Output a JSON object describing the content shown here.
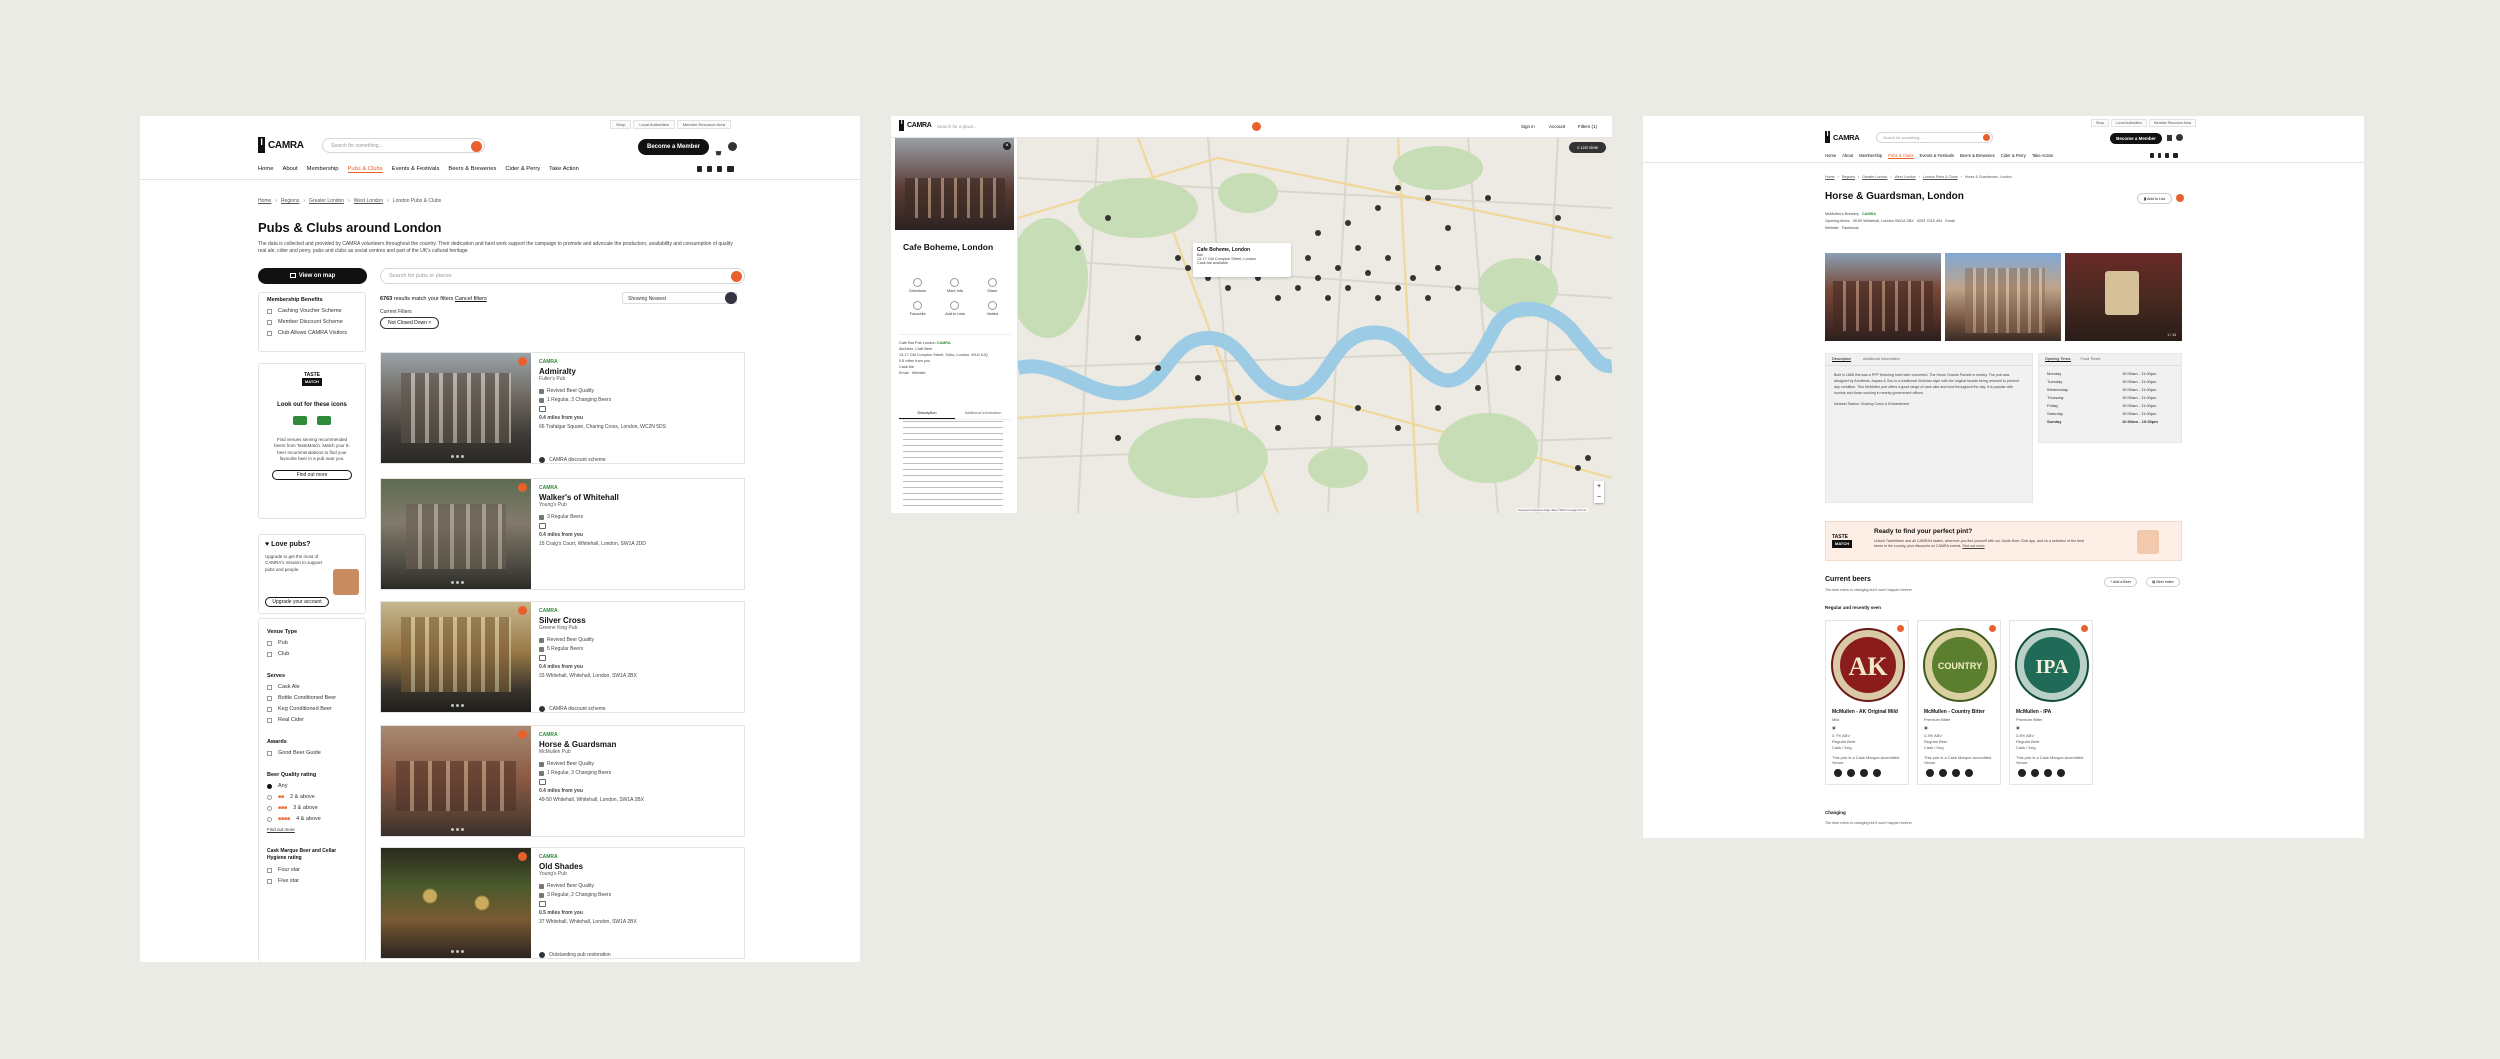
{
  "colors": {
    "accent": "#e8602c",
    "dark": "#111111",
    "green": "#2e8b3a",
    "page_bg": "#ebebe6"
  },
  "brand": {
    "logo_text": "CAMRA",
    "member_button": "Become a Member"
  },
  "search_placeholder": "Search for something...",
  "utility_links": [
    "Shop",
    "Local Authorities",
    "Member Resource Area"
  ],
  "nav": [
    "Home",
    "About",
    "Membership",
    "Pubs & Clubs",
    "Events & Festivals",
    "Beers & Breweries",
    "Cider & Perry",
    "Take Action"
  ],
  "listing": {
    "breadcrumb": [
      "Home",
      "Regions",
      "Greater London",
      "West London",
      "London Pubs & Clubs"
    ],
    "title": "Pubs & Clubs around London",
    "description": "The data is collected and provided by CAMRA volunteers throughout the country. Their dedication and hard work support the campaign to promote and advocate the production, availability and consumption of quality real ale, cider and perry, pubs and clubs as social centres and part of the UK's cultural heritage.",
    "view_map": "View on map",
    "pub_search_placeholder": "Search for pubs or places",
    "results_count": "6763",
    "results_text": "results match your filters",
    "cancel_filters": "Cancel filters",
    "sort": "Showing Nearest",
    "current_filters_label": "Current Filters",
    "current_filter_chip": "Not Closed Down",
    "membership_benefits": {
      "title": "Membership Benefits",
      "items": [
        "Cashing Voucher Scheme",
        "Member Discount Scheme",
        "Club Allows CAMRA Visitors"
      ]
    },
    "taste": {
      "logo_top": "TASTE",
      "logo_bottom": "MATCH",
      "heading": "Look out for these icons",
      "body": "Find venues serving recommended beers from TasteMatch. Match your 5-beer recommendations to find your favourite beer in a pub near you.",
      "button": "Find out more"
    },
    "love": {
      "heading": "Love pubs?",
      "body": "Upgrade to get the most of CAMRA's mission to support pubs and people.",
      "button": "Upgrade your account"
    },
    "venue_type": {
      "title": "Venue Type",
      "items": [
        "Pub",
        "Club"
      ]
    },
    "serves": {
      "title": "Serves",
      "items": [
        "Cask Ale",
        "Bottle Conditioned Beer",
        "Keg Conditioned Beer",
        "Real Cider"
      ]
    },
    "awards": {
      "title": "Awards",
      "items": [
        "Good Beer Guide"
      ]
    },
    "beer_rating": {
      "title": "Beer Quality rating",
      "items": [
        "Any",
        "2 & above",
        "3 & above",
        "4 & above"
      ],
      "link": "Find out more"
    },
    "last_filter": {
      "title": "Cask Marque Beer and Cellar Hygiene rating",
      "items": [
        "Four star",
        "Five star"
      ]
    },
    "pubs": [
      {
        "badge": "CAMRA",
        "name": "Admiralty",
        "type": "Fuller's Pub",
        "lines": [
          "Revived Beer Quality",
          "1 Regular, 3 Changing Beers",
          "",
          "0.4 miles from you",
          "66 Trafalgar Square, Charing Cross, London, WC2N 5DS"
        ],
        "note": "CAMRA discount scheme"
      },
      {
        "badge": "CAMRA",
        "name": "Walker's of Whitehall",
        "type": "Young's Pub",
        "lines": [
          "3 Regular Beers",
          "",
          "0.4 miles from you",
          "15 Craig's Court, Whitehall, London, SW1A 2DD"
        ],
        "note": ""
      },
      {
        "badge": "CAMRA",
        "name": "Silver Cross",
        "type": "Greene King Pub",
        "lines": [
          "Revived Beer Quality",
          "5 Regular Beers",
          "",
          "0.4 miles from you",
          "33 Whitehall, Whitehall, London, SW1A 2BX"
        ],
        "note": "CAMRA discount scheme"
      },
      {
        "badge": "CAMRA",
        "name": "Horse & Guardsman",
        "type": "McMullen Pub",
        "lines": [
          "Revived Beer Quality",
          "1 Regular, 3 Changing Beers",
          "",
          "0.4 miles from you",
          "49-50 Whitehall, Whitehall, London, SW1A 2BX"
        ],
        "note": ""
      },
      {
        "badge": "CAMRA",
        "name": "Old Shades",
        "type": "Young's Pub",
        "lines": [
          "Revived Beer Quality",
          "3 Regular, 2 Changing Beers",
          "",
          "0.5 miles from you",
          "37 Whitehall, Whitehall, London, SW1A 2BX"
        ],
        "note": "Outstanding pub restoration"
      }
    ]
  },
  "map_view": {
    "search_placeholder": "Search for a place...",
    "top_links": [
      "Sign in",
      "Account",
      "Filters (1)"
    ],
    "list_view": "List view",
    "venue_name": "Cafe Boheme, London",
    "actions": [
      "Directions",
      "More Info",
      "Share",
      "Favourite",
      "Add to Lists",
      "Visited"
    ],
    "camra_label": "CAMRA",
    "details": [
      "Cafe Bar Pub London",
      "Ale/beer, Craft Beer",
      "13-17 Old Compton Street, Soho, London, W1D 5JQ",
      "0.8 miles from you",
      "Cask Ale",
      "Email",
      "Website"
    ],
    "tabs": [
      "Description",
      "Additional Information"
    ],
    "popup_title": "Cafe Boheme, London",
    "popup_lines": [
      "Bar",
      "13-17 Old Compton Street, London",
      "Cask Ale available"
    ],
    "attribution": "Keyboard shortcuts  Map data ©2023 Google  Terms"
  },
  "detail": {
    "breadcrumb": [
      "Home",
      "Regions",
      "Greater London",
      "West London",
      "London Pubs & Clubs",
      "Horse & Guardsman, London"
    ],
    "title": "Horse & Guardsman, London",
    "save_button": "Add to List",
    "meta": [
      "McMullen's Brewery",
      "CAMRA",
      "Opening times",
      "49-50 Whitehall, London SW1A 2BX",
      "0203 7015 404",
      "Email",
      "Website",
      "Facebook"
    ],
    "tabs": [
      "Description",
      "Additional Information"
    ],
    "hours_tabs": [
      "Opening Times",
      "Food Times"
    ],
    "description": "Built in 1888 this was a PPP Motoring hotel later converted. The Horse Guards Parade is nearby. The pub was designed by Architects Jaques & Son to a traditional Victorian style with the original facade being restored to present day condition. This McMullen pub offers a good range of cask ales and food throughout the day. It is popular with tourists and those working in nearby government offices.",
    "nearest": "Nearest Station: Charing Cross & Embankment",
    "hours": [
      [
        "Monday",
        "10:00am - 11:00pm"
      ],
      [
        "Tuesday",
        "10:00am - 11:00pm"
      ],
      [
        "Wednesday",
        "10:00am - 11:00pm"
      ],
      [
        "Thursday",
        "10:00am - 11:00pm"
      ],
      [
        "Friday",
        "10:00am - 11:00pm"
      ],
      [
        "Saturday",
        "10:00am - 11:00pm"
      ],
      [
        "Sunday",
        "10:00am - 10:30pm"
      ]
    ],
    "taste_banner": {
      "heading": "Ready to find your perfect pint?",
      "body": "Unlock TasteMatch and all CAMRA's tastes, wherever you find yourself with our Guide Beer Club app, and on a selection of the best beers in the country, plus discounts on CAMRA events.",
      "link": "Find out more"
    },
    "current_beers": "Current beers",
    "current_beers_sub": "The beer menu is changing but it won't happen forever.",
    "beer_buttons": [
      "Add a Beer",
      "Beer Index"
    ],
    "regular_label": "Regular and recently seen",
    "beers": [
      {
        "badge": "AK",
        "name": "McMullen - AK Original Mild",
        "style": "Mild",
        "abv": "3.7% ABV",
        "lines": [
          "3.7% ABV",
          "Regular Beer",
          "Cask / Keg"
        ],
        "color": "#8a1c1c",
        "ring": "#d9c9a6"
      },
      {
        "badge": "COUNTRY",
        "name": "McMullen - Country Bitter",
        "style": "Premium Bitter",
        "abv": "4.3% ABV",
        "lines": [
          "4.3% ABV",
          "Regular Beer",
          "Cask / Keg"
        ],
        "color": "#5b7f2e",
        "ring": "#d9d2a0"
      },
      {
        "badge": "IPA",
        "name": "McMullen - IPA",
        "style": "Premium Bitter",
        "abv": "3.8% ABV",
        "lines": [
          "3.8% ABV",
          "Regular Beer",
          "Cask / Keg"
        ],
        "color": "#1f6b57",
        "ring": "#b9d0c7"
      }
    ],
    "beer_footer": "This pub is a Cask Marque Accredited Venue",
    "changing_label": "Changing",
    "changing_sub": "The beer menu is changing but it won't happen forever."
  }
}
